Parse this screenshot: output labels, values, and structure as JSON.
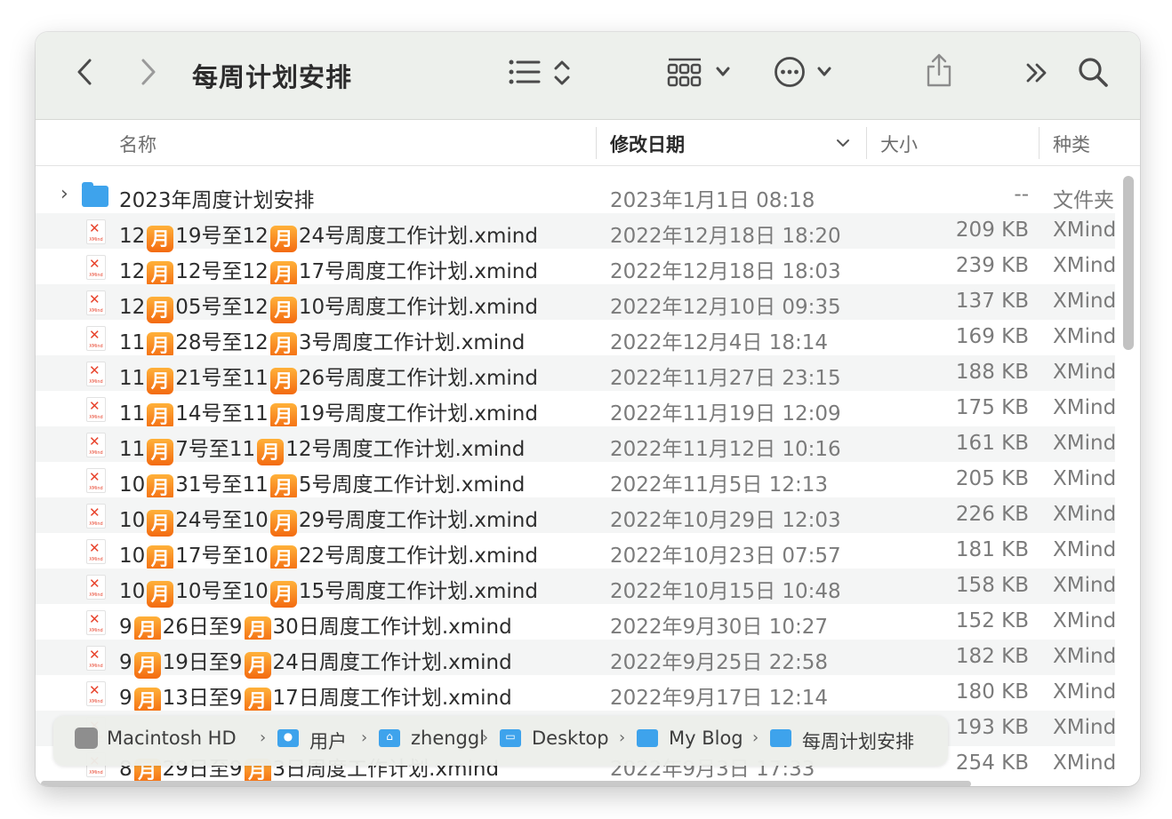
{
  "window": {
    "title": "每周计划安排"
  },
  "toolbar": {
    "back_icon": "chevron-left-icon",
    "forward_icon": "chevron-right-icon",
    "list_view_icon": "list-view-icon",
    "group_icon": "group-grid-icon",
    "more_icon": "ellipsis-circle-icon",
    "share_icon": "share-icon",
    "overflow_icon": "double-chevron-icon",
    "search_icon": "search-icon"
  },
  "columns": {
    "name": "名称",
    "date": "修改日期",
    "size": "大小",
    "kind": "种类"
  },
  "rows": [
    {
      "type": "folder",
      "name_parts": [
        "2023年周度计划安排"
      ],
      "date": "2023年1月1日 08:18",
      "size": "--",
      "kind": "文件夹"
    },
    {
      "type": "file",
      "name_parts": [
        "12",
        "月",
        "19号至12",
        "月",
        "24号周度工作计划.xmind"
      ],
      "date": "2022年12月18日 18:20",
      "size": "209 KB",
      "kind": "XMind"
    },
    {
      "type": "file",
      "name_parts": [
        "12",
        "月",
        "12号至12",
        "月",
        "17号周度工作计划.xmind"
      ],
      "date": "2022年12月18日 18:03",
      "size": "239 KB",
      "kind": "XMind"
    },
    {
      "type": "file",
      "name_parts": [
        "12",
        "月",
        "05号至12",
        "月",
        "10号周度工作计划.xmind"
      ],
      "date": "2022年12月10日 09:35",
      "size": "137 KB",
      "kind": "XMind"
    },
    {
      "type": "file",
      "name_parts": [
        "11",
        "月",
        "28号至12",
        "月",
        "3号周度工作计划.xmind"
      ],
      "date": "2022年12月4日 18:14",
      "size": "169 KB",
      "kind": "XMind"
    },
    {
      "type": "file",
      "name_parts": [
        "11",
        "月",
        "21号至11",
        "月",
        "26号周度工作计划.xmind"
      ],
      "date": "2022年11月27日 23:15",
      "size": "188 KB",
      "kind": "XMind"
    },
    {
      "type": "file",
      "name_parts": [
        "11",
        "月",
        "14号至11",
        "月",
        "19号周度工作计划.xmind"
      ],
      "date": "2022年11月19日 12:09",
      "size": "175 KB",
      "kind": "XMind"
    },
    {
      "type": "file",
      "name_parts": [
        "11",
        "月",
        "7号至11",
        "月",
        "12号周度工作计划.xmind"
      ],
      "date": "2022年11月12日 10:16",
      "size": "161 KB",
      "kind": "XMind"
    },
    {
      "type": "file",
      "name_parts": [
        "10",
        "月",
        "31号至11",
        "月",
        "5号周度工作计划.xmind"
      ],
      "date": "2022年11月5日 12:13",
      "size": "205 KB",
      "kind": "XMind"
    },
    {
      "type": "file",
      "name_parts": [
        "10",
        "月",
        "24号至10",
        "月",
        "29号周度工作计划.xmind"
      ],
      "date": "2022年10月29日 12:03",
      "size": "226 KB",
      "kind": "XMind"
    },
    {
      "type": "file",
      "name_parts": [
        "10",
        "月",
        "17号至10",
        "月",
        "22号周度工作计划.xmind"
      ],
      "date": "2022年10月23日 07:57",
      "size": "181 KB",
      "kind": "XMind"
    },
    {
      "type": "file",
      "name_parts": [
        "10",
        "月",
        "10号至10",
        "月",
        "15号周度工作计划.xmind"
      ],
      "date": "2022年10月15日 10:48",
      "size": "158 KB",
      "kind": "XMind"
    },
    {
      "type": "file",
      "name_parts": [
        "9",
        "月",
        "26日至9",
        "月",
        "30日周度工作计划.xmind"
      ],
      "date": "2022年9月30日 10:27",
      "size": "152 KB",
      "kind": "XMind"
    },
    {
      "type": "file",
      "name_parts": [
        "9",
        "月",
        "19日至9",
        "月",
        "24日周度工作计划.xmind"
      ],
      "date": "2022年9月25日 22:58",
      "size": "182 KB",
      "kind": "XMind"
    },
    {
      "type": "file",
      "name_parts": [
        "9",
        "月",
        "13日至9",
        "月",
        "17日周度工作计划.xmind"
      ],
      "date": "2022年9月17日 12:14",
      "size": "180 KB",
      "kind": "XMind"
    },
    {
      "type": "file",
      "name_parts": [
        ""
      ],
      "date": "",
      "size": "193 KB",
      "kind": "XMind"
    },
    {
      "type": "file",
      "name_parts": [
        "8",
        "月",
        "29日至9",
        "月",
        "3日周度工作计划.xmind"
      ],
      "date": "2022年9月3日 17:33",
      "size": "254 KB",
      "kind": "XMind"
    }
  ],
  "file_icon_text": "XMind",
  "pathbar": {
    "items": [
      {
        "label": "Macintosh HD",
        "icon": "disk-icon"
      },
      {
        "label": "用户",
        "icon": "users-folder-icon"
      },
      {
        "label": "zhenggl",
        "icon": "home-folder-icon"
      },
      {
        "label": "Desktop",
        "icon": "desktop-folder-icon"
      },
      {
        "label": "My Blog",
        "icon": "folder-icon"
      },
      {
        "label": "每周计划安排",
        "icon": "folder-icon"
      }
    ]
  },
  "colors": {
    "folder": "#3ea3ec",
    "month_badge": "#f57a14",
    "xmind_red": "#e8442d",
    "toolbar_bg": "#edf0ec"
  }
}
